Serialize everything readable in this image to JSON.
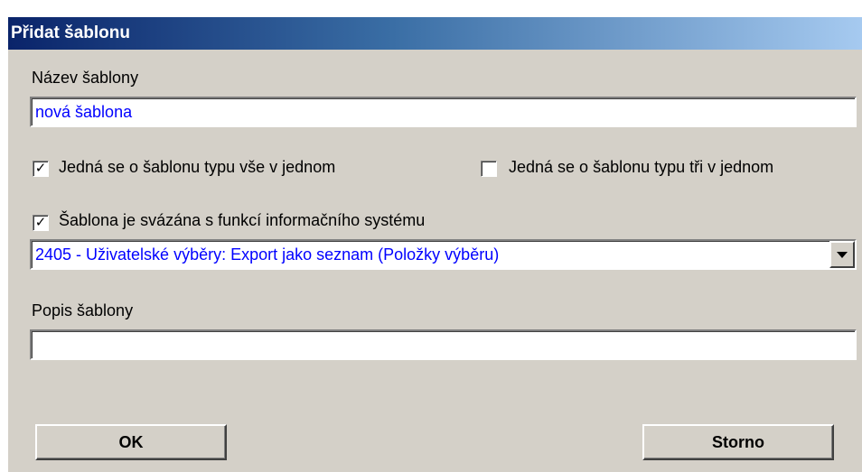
{
  "dialog": {
    "title": "Přidat šablonu",
    "name_label": "Název šablony",
    "name_value": "nová šablona",
    "checkbox_all_in_one": {
      "label": "Jedná se o šablonu typu vše v jednom",
      "checked": true
    },
    "checkbox_three_in_one": {
      "label": "Jedná se o šablonu typu tři v jednom",
      "checked": false
    },
    "checkbox_linked": {
      "label": "Šablona je svázána s funkcí informačního systému",
      "checked": true
    },
    "function_select_value": "2405 - Uživatelské výběry: Export jako seznam (Položky výběru)",
    "description_label": "Popis šablony",
    "description_value": "",
    "ok_label": "OK",
    "cancel_label": "Storno"
  }
}
